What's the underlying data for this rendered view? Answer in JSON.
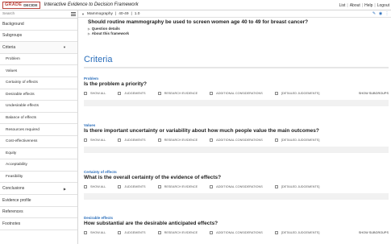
{
  "header": {
    "logo_grade": "GRADE",
    "logo_decide": "DECIDE",
    "title": "Interactive Evidence to Decision Framework",
    "nav": [
      "List",
      "About",
      "Help",
      "Logout"
    ]
  },
  "sidebar": {
    "search_placeholder": "Search",
    "items": [
      {
        "label": "Background"
      },
      {
        "label": "Subgroups"
      },
      {
        "label": "Criteria"
      },
      {
        "label": "Problem"
      },
      {
        "label": "Values"
      },
      {
        "label": "Certainty of effects"
      },
      {
        "label": "Desirable effects"
      },
      {
        "label": "Undesirable effects"
      },
      {
        "label": "Balance of effects"
      },
      {
        "label": "Resources required"
      },
      {
        "label": "Cost-effectiveness"
      },
      {
        "label": "Equity"
      },
      {
        "label": "Acceptability"
      },
      {
        "label": "Feasibility"
      },
      {
        "label": "Conclusions"
      },
      {
        "label": "Evidence profile"
      },
      {
        "label": "References"
      },
      {
        "label": "Footnotes"
      }
    ]
  },
  "breadcrumb": {
    "topic": "Mammography",
    "age": "40-49",
    "version": "1.0"
  },
  "question": {
    "text": "Should routine mammography be used to screen women age 40 to 49 for breast cancer?",
    "details_link": "Question details",
    "framework_link": "About this framework"
  },
  "criteria_title": "Criteria",
  "option_labels": [
    "SHOW ALL",
    "JUDGEMENTS",
    "RESEARCH EVIDENCE",
    "ADDITIONAL CONSIDERATIONS",
    "[DETAILED JUDGEMENTS]"
  ],
  "show_subgroups": "SHOW SUBGROUPS",
  "sections": [
    {
      "label": "Problem",
      "question": "Is the problem a priority?"
    },
    {
      "label": "Values",
      "question": "Is there important uncertainty or variability about how much people value the main outcomes?"
    },
    {
      "label": "Certainty of effects",
      "question": "What is the overall certainty of the evidence of effects?"
    },
    {
      "label": "Desirable effects",
      "question": "How substantial are the desirable anticipated effects?"
    }
  ]
}
